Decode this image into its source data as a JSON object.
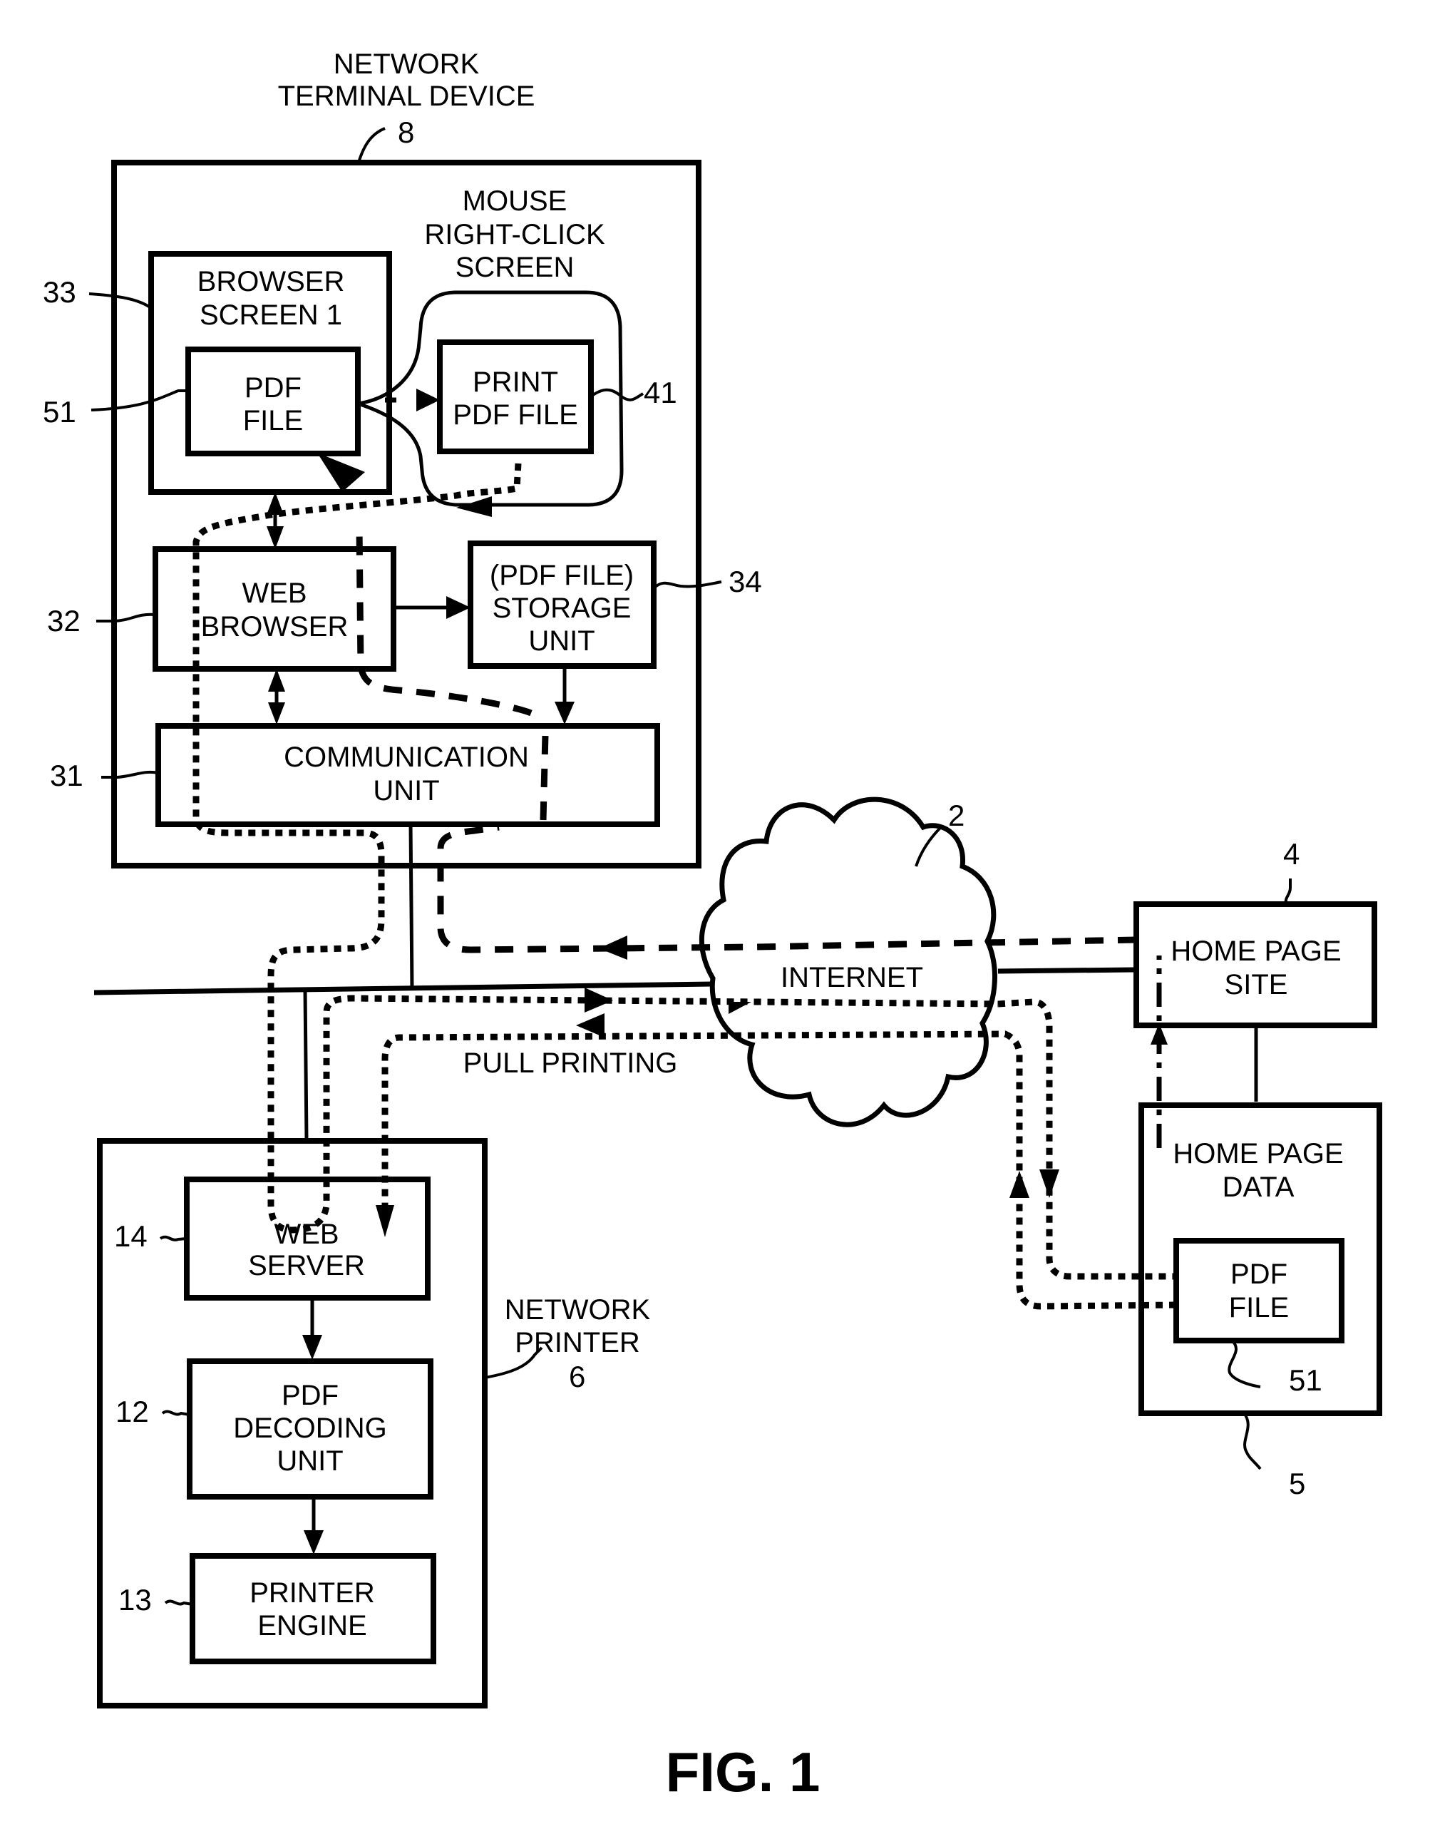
{
  "figure": {
    "caption": "FIG. 1"
  },
  "network_terminal_device": {
    "title_line1": "NETWORK",
    "title_line2": "TERMINAL DEVICE",
    "ref": "8",
    "browser_screen": {
      "line1": "BROWSER",
      "line2": "SCREEN 1",
      "ref": "33"
    },
    "pdf_file": {
      "line1": "PDF",
      "line2": "FILE",
      "ref": "51"
    },
    "mouse_menu": {
      "line1": "MOUSE",
      "line2": "RIGHT-CLICK",
      "line3": "SCREEN"
    },
    "print_pdf_file": {
      "line1": "PRINT",
      "line2": "PDF FILE",
      "ref": "41"
    },
    "web_browser": {
      "line1": "WEB",
      "line2": "BROWSER",
      "ref": "32"
    },
    "storage_unit": {
      "line1": "(PDF FILE)",
      "line2": "STORAGE",
      "line3": "UNIT",
      "ref": "34"
    },
    "communication_unit": {
      "line1": "COMMUNICATION",
      "line2": "UNIT",
      "ref": "31"
    }
  },
  "internet": {
    "label": "INTERNET",
    "ref": "2"
  },
  "pull_printing": {
    "label": "PULL PRINTING"
  },
  "home_page_site": {
    "line1": "HOME PAGE",
    "line2": "SITE",
    "ref": "4"
  },
  "home_page_data": {
    "line1": "HOME PAGE",
    "line2": "DATA",
    "ref": "5",
    "pdf_file": {
      "line1": "PDF",
      "line2": "FILE",
      "ref": "51"
    }
  },
  "network_printer": {
    "title_line1": "NETWORK",
    "title_line2": "PRINTER",
    "ref": "6",
    "web_server": {
      "line1": "WEB",
      "line2": "SERVER",
      "ref": "14"
    },
    "pdf_decoding_unit": {
      "line1": "PDF",
      "line2": "DECODING",
      "line3": "UNIT",
      "ref": "12"
    },
    "printer_engine": {
      "line1": "PRINTER",
      "line2": "ENGINE",
      "ref": "13"
    }
  }
}
